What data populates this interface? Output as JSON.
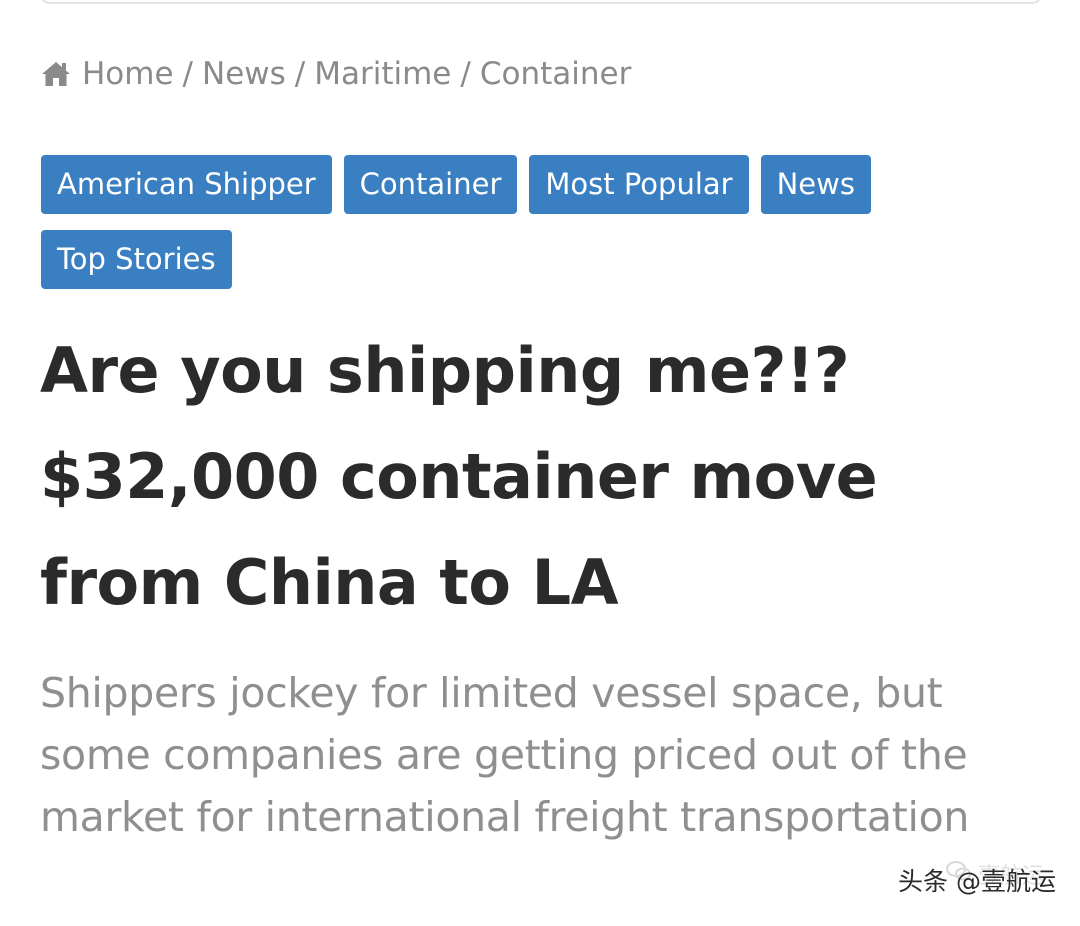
{
  "breadcrumb": {
    "icon": "home-icon",
    "items": [
      "Home",
      "News",
      "Maritime",
      "Container"
    ],
    "separator": "/"
  },
  "tags": [
    "American Shipper",
    "Container",
    "Most Popular",
    "News",
    "Top Stories"
  ],
  "article": {
    "title": "Are you shipping me?!? $32,000 container move from China to LA",
    "subtitle": "Shippers jockey for limited vessel space, but some companies are getting priced out of the market for international freight transportation"
  },
  "watermark": {
    "text": "头条 @壹航运",
    "faded_text": "壹航运",
    "faded_icon": "wechat-icon"
  },
  "colors": {
    "tag_background": "#3a7fc2",
    "title": "#2b2b2b",
    "subtitle": "#8f8f8f",
    "breadcrumb": "#8a8a8a"
  }
}
